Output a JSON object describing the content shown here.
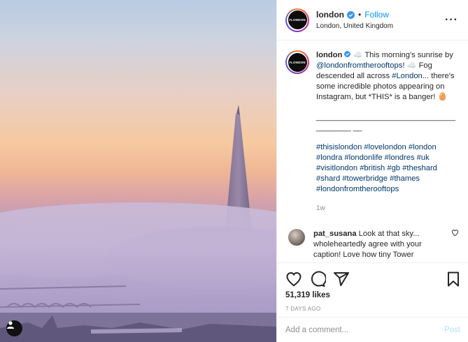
{
  "post": {
    "username": "london",
    "avatar_text": "#LONDON",
    "follow_label": "Follow",
    "location": "London, United Kingdom",
    "more_icon": "more-icon"
  },
  "caption": {
    "username": "london",
    "line1": "☁️ This morning's sunrise by ",
    "mention": "@londonfromtherooftops",
    "line2": "! ☁️ Fog descended all across ",
    "hashtag_inline": "#London",
    "line3": "... there's some incredible photos appearing on Instagram, but *THIS* is a banger! 🥚",
    "divider": "________________________________________ __",
    "hashtags": "#thisislondon #lovelondon #london #londra #londonlife #londres #uk #visitlondon #british #gb #theshard #shard #towerbridge #thames #londonfromtherooftops",
    "age": "1w"
  },
  "comment": {
    "username": "pat_susana",
    "text": "Look at that sky... wholeheartedly agree with your caption! Love how tiny Tower"
  },
  "actions": {
    "likes": "51,319 likes",
    "date": "7 DAYS AGO"
  },
  "composer": {
    "placeholder": "Add a comment...",
    "post_label": "Post"
  },
  "colors": {
    "link": "#00376b",
    "follow": "#0095f6",
    "post_disabled": "#b2dffc"
  }
}
